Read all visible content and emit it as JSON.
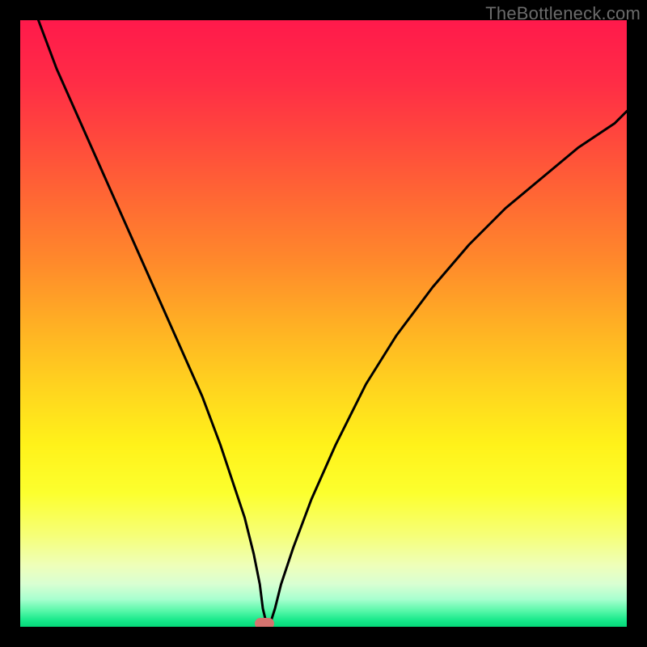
{
  "watermark": "TheBottleneck.com",
  "colors": {
    "marker": "#d5736f",
    "curve": "#000000"
  },
  "gradient_stops": [
    {
      "pos": 0.0,
      "color": "#ff1a4b"
    },
    {
      "pos": 0.1,
      "color": "#ff2c46"
    },
    {
      "pos": 0.2,
      "color": "#ff4a3c"
    },
    {
      "pos": 0.3,
      "color": "#ff6a33"
    },
    {
      "pos": 0.4,
      "color": "#ff8a2b"
    },
    {
      "pos": 0.5,
      "color": "#ffaf24"
    },
    {
      "pos": 0.6,
      "color": "#ffd21f"
    },
    {
      "pos": 0.7,
      "color": "#fff21a"
    },
    {
      "pos": 0.78,
      "color": "#fcff2e"
    },
    {
      "pos": 0.85,
      "color": "#f6ff78"
    },
    {
      "pos": 0.9,
      "color": "#eeffba"
    },
    {
      "pos": 0.93,
      "color": "#d9ffd2"
    },
    {
      "pos": 0.955,
      "color": "#a8ffcf"
    },
    {
      "pos": 0.975,
      "color": "#55f7a8"
    },
    {
      "pos": 0.99,
      "color": "#17e88a"
    },
    {
      "pos": 1.0,
      "color": "#06d97a"
    }
  ],
  "chart_data": {
    "type": "line",
    "title": "",
    "xlabel": "",
    "ylabel": "",
    "xlim": [
      0,
      100
    ],
    "ylim": [
      0,
      100
    ],
    "grid": false,
    "legend": false,
    "series": [
      {
        "name": "bottleneck-curve",
        "x": [
          3,
          6,
          10,
          14,
          18,
          22,
          26,
          30,
          33,
          35,
          37,
          38.5,
          39.5,
          40,
          40.6,
          41.2,
          42,
          43,
          45,
          48,
          52,
          57,
          62,
          68,
          74,
          80,
          86,
          92,
          98,
          100
        ],
        "y": [
          100,
          92,
          83,
          74,
          65,
          56,
          47,
          38,
          30,
          24,
          18,
          12,
          7,
          3,
          0.5,
          0.5,
          3,
          7,
          13,
          21,
          30,
          40,
          48,
          56,
          63,
          69,
          74,
          79,
          83,
          85
        ]
      }
    ],
    "marker": {
      "x": 40.3,
      "y": 0.6
    }
  }
}
